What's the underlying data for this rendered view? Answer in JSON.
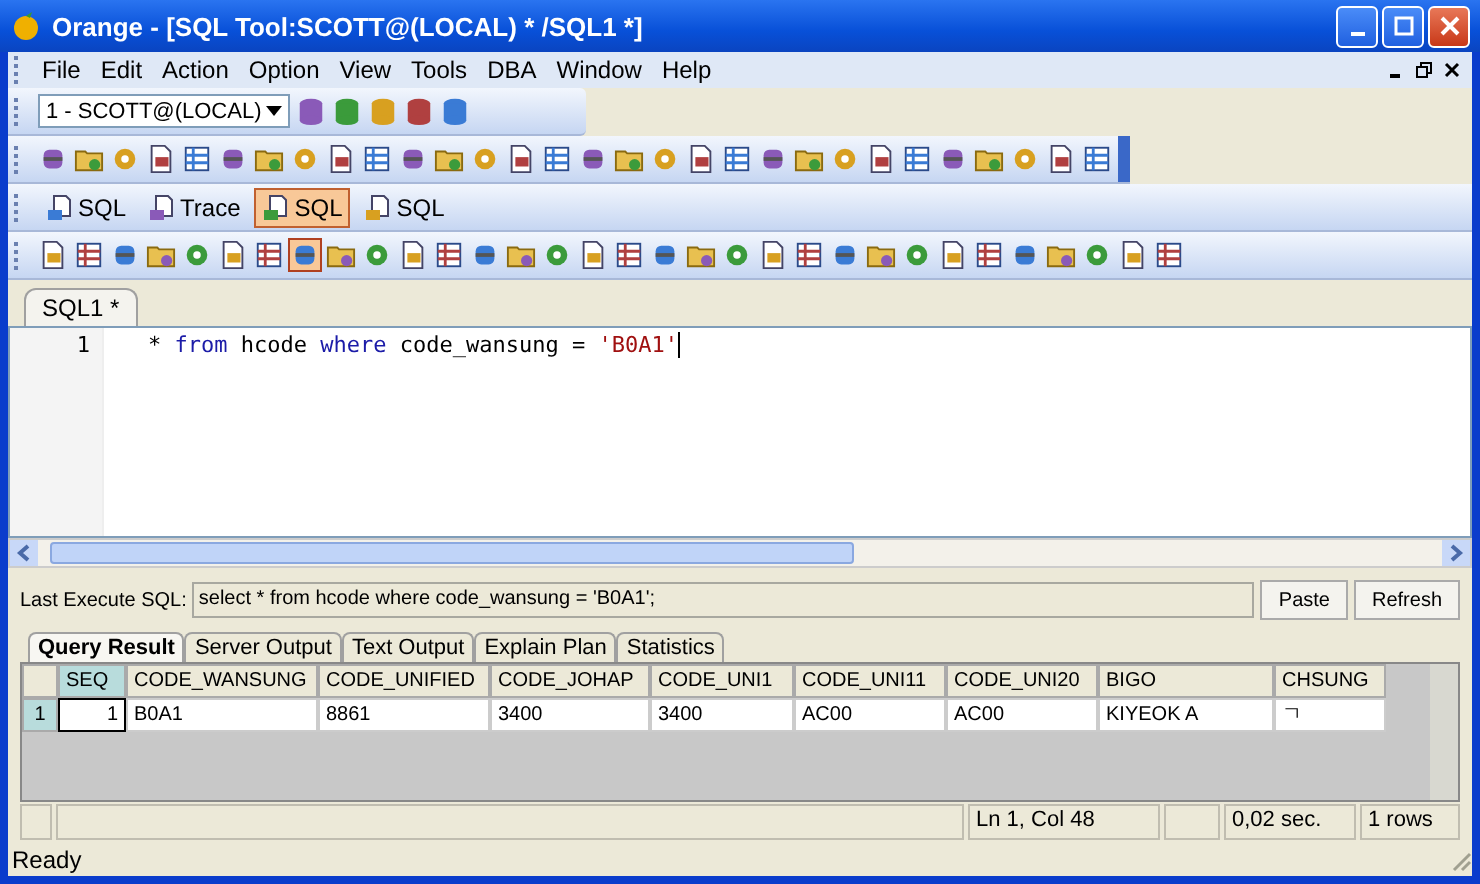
{
  "window": {
    "title": "Orange - [SQL Tool:SCOTT@(LOCAL) * /SQL1 *]"
  },
  "menu": [
    "File",
    "Edit",
    "Action",
    "Option",
    "View",
    "Tools",
    "DBA",
    "Window",
    "Help"
  ],
  "connection": {
    "value": "1 - SCOTT@(LOCAL)"
  },
  "tool_buttons": [
    {
      "label": "SQL",
      "selected": false
    },
    {
      "label": "Trace",
      "selected": false
    },
    {
      "label": "SQL",
      "selected": true
    },
    {
      "label": "SQL",
      "selected": false
    }
  ],
  "editor_tab": {
    "label": "SQL1 *"
  },
  "editor": {
    "line_number": "1",
    "tokens": [
      {
        "kind": "plain",
        "text": "* "
      },
      {
        "kind": "keyword",
        "text": "from"
      },
      {
        "kind": "plain",
        "text": " hcode "
      },
      {
        "kind": "keyword",
        "text": "where"
      },
      {
        "kind": "plain",
        "text": " code_wansung = "
      },
      {
        "kind": "string",
        "text": "'B0A1'"
      }
    ]
  },
  "last_execute": {
    "label": "Last Execute SQL:",
    "value": "select * from hcode where code_wansung = 'B0A1';"
  },
  "buttons": [
    "Paste",
    "Refresh"
  ],
  "result_tabs": [
    {
      "label": "Query Result",
      "selected": true
    },
    {
      "label": "Server Output",
      "selected": false
    },
    {
      "label": "Text Output",
      "selected": false
    },
    {
      "label": "Explain Plan",
      "selected": false
    },
    {
      "label": "Statistics",
      "selected": false
    }
  ],
  "table": {
    "columns": [
      {
        "label": "SEQ",
        "selected": true
      },
      {
        "label": "CODE_WANSUNG",
        "selected": false
      },
      {
        "label": "CODE_UNIFIED",
        "selected": false
      },
      {
        "label": "CODE_JOHAP",
        "selected": false
      },
      {
        "label": "CODE_UNI1",
        "selected": false
      },
      {
        "label": "CODE_UNI11",
        "selected": false
      },
      {
        "label": "CODE_UNI20",
        "selected": false
      },
      {
        "label": "BIGO",
        "selected": false
      },
      {
        "label": "CHSUNG",
        "selected": false
      }
    ],
    "rows": [
      {
        "number": "1",
        "selected": true,
        "cells": [
          "1",
          "B0A1",
          "8861",
          "3400",
          "3400",
          "AC00",
          "AC00",
          "KIYEOK A",
          "ㄱ"
        ]
      }
    ]
  },
  "status_panels": [
    "Ln 1, Col 48",
    "0,02 sec.",
    "1 rows"
  ],
  "status_bar": "Ready"
}
